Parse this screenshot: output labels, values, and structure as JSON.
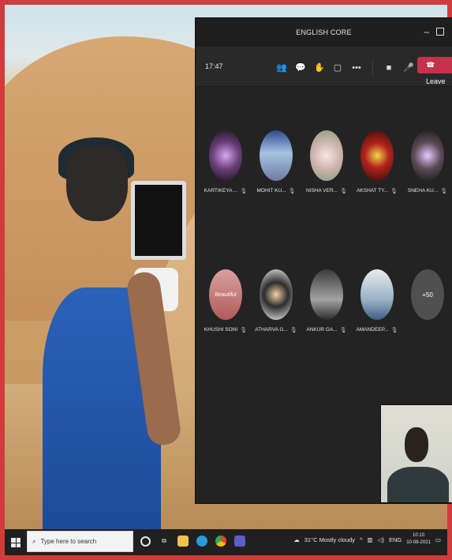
{
  "window": {
    "title": "ENGLISH CORE"
  },
  "toolbar": {
    "time": "17:47",
    "leave_label": "Leave",
    "icons": [
      "people-icon",
      "chat-icon",
      "raise-hand-icon",
      "rooms-icon",
      "more-icon",
      "camera-icon",
      "mic-icon",
      "share-icon"
    ]
  },
  "participants": [
    {
      "name": "KARTIKEYA ...",
      "avatar_color": "#6a3f7a"
    },
    {
      "name": "MOHIT KU...",
      "avatar_color": "#5a79a8"
    },
    {
      "name": "NISHA VER...",
      "avatar_color": "#b9a19b"
    },
    {
      "name": "AKSHAT TY...",
      "avatar_color": "#b3231c"
    },
    {
      "name": "SNEHA KU...",
      "avatar_color": "#5b4a57"
    },
    {
      "name": "KHUSHI SONI",
      "avatar_color": "#c77c7c"
    },
    {
      "name": "ATHARVA G...",
      "avatar_color": "#f0f0f0"
    },
    {
      "name": "ANKUR GA...",
      "avatar_color": "#6f6f6f"
    },
    {
      "name": "AMANDEEP...",
      "avatar_color": "#607b8f"
    }
  ],
  "overflow": {
    "label": "+50"
  },
  "avatar_text": "Beautiful",
  "taskbar": {
    "search_placeholder": "Type here to search",
    "weather": "31°C  Mostly cloudy",
    "language": "ENG",
    "clock_time": "10:10",
    "clock_date": "10-08-2021"
  }
}
